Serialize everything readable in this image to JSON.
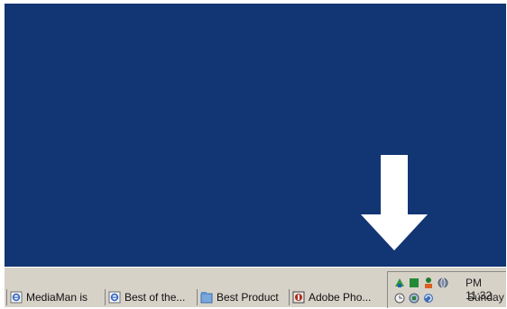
{
  "taskbar": {
    "buttons": [
      {
        "label": "MediaMan is",
        "icon": "ie-page-icon"
      },
      {
        "label": "Best of the...",
        "icon": "ie-page-icon"
      },
      {
        "label": "Best Product",
        "icon": "folder-window-icon"
      },
      {
        "label": "Adobe Pho...",
        "icon": "adobe-photoshop-icon"
      }
    ]
  },
  "tray": {
    "time": "PM 11:32",
    "day": "Sunday",
    "icons": [
      "network-icon",
      "green-square-icon",
      "user-status-icon",
      "globe-icon",
      "clock-icon",
      "app-icon",
      "refresh-globe-icon"
    ]
  },
  "colors": {
    "desktop": "#123574",
    "taskbar": "#d7d2c8",
    "arrow": "#ffffff"
  }
}
